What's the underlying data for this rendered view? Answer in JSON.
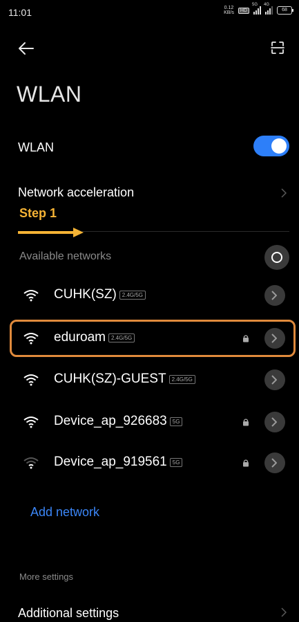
{
  "status_bar": {
    "time": "11:01",
    "speed_value": "0.12",
    "speed_unit": "KB/s",
    "hd_label": "HD",
    "signal1_label": "5G",
    "signal2_label": "4G",
    "battery_level": "68"
  },
  "header": {
    "back_icon": "arrow-left-icon",
    "scan_icon": "scan-icon",
    "title": "WLAN"
  },
  "wlan_toggle": {
    "label": "WLAN",
    "on": true,
    "color": "#2d7ff9"
  },
  "network_acceleration": {
    "label": "Network acceleration"
  },
  "annotation": {
    "step_label": "Step 1",
    "color": "#f5b335",
    "highlight_color": "#e08a3c"
  },
  "available_networks": {
    "header": "Available networks",
    "items": [
      {
        "name": "CUHK(SZ)",
        "band": "2.4G/5G",
        "locked": false,
        "signal": "strong"
      },
      {
        "name": "eduroam",
        "band": "2.4G/5G",
        "locked": true,
        "signal": "strong",
        "highlighted": true
      },
      {
        "name": "CUHK(SZ)-GUEST",
        "band": "2.4G/5G",
        "locked": false,
        "signal": "strong"
      },
      {
        "name": "Device_ap_926683",
        "band": "5G",
        "locked": true,
        "signal": "strong"
      },
      {
        "name": "Device_ap_919561",
        "band": "5G",
        "locked": true,
        "signal": "weak"
      }
    ]
  },
  "add_network": {
    "label": "Add network",
    "color": "#3b86f7"
  },
  "more_settings": {
    "header": "More settings",
    "additional_label": "Additional settings"
  }
}
